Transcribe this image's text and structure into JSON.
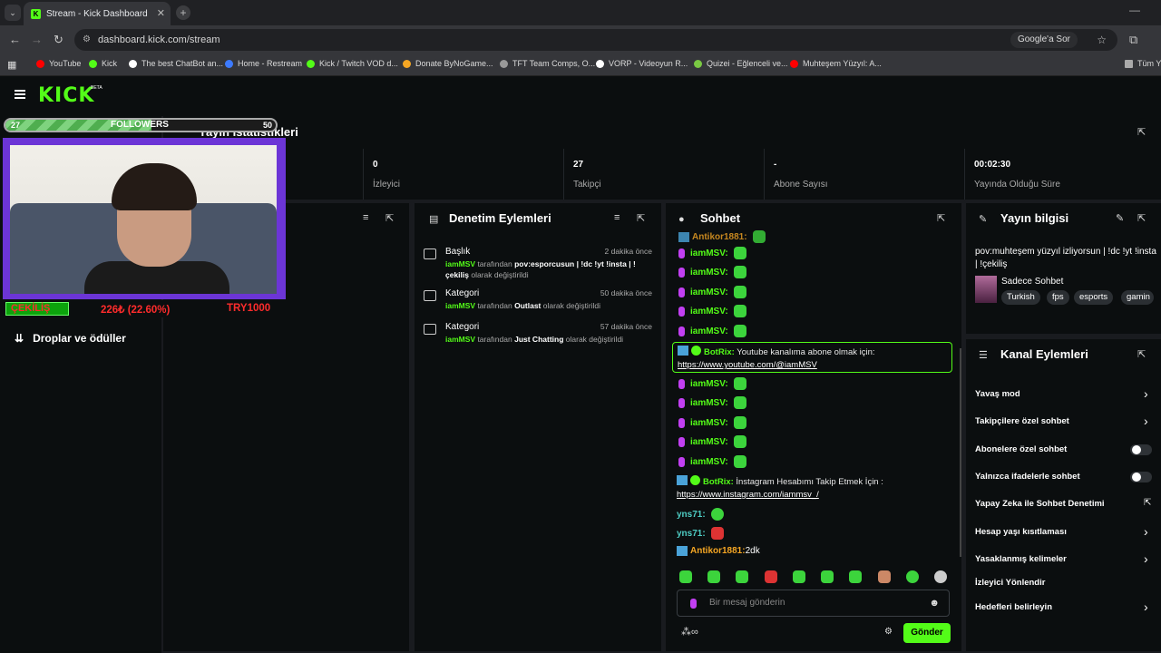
{
  "browser": {
    "tab_title": "Stream - Kick Dashboard",
    "url": "dashboard.kick.com/stream",
    "google_sor": "Google'a Sor",
    "bookmarks": [
      {
        "label": "YouTube",
        "color": "#ff0000"
      },
      {
        "label": "Kick",
        "color": "#53fc18"
      },
      {
        "label": "The best ChatBot an...",
        "color": "#ffffff"
      },
      {
        "label": "Home - Restream",
        "color": "#3d7bff"
      },
      {
        "label": "Kick / Twitch VOD d...",
        "color": "#53fc18"
      },
      {
        "label": "Donate ByNoGame...",
        "color": "#f5a623"
      },
      {
        "label": "TFT Team Comps, O...",
        "color": "#999999"
      },
      {
        "label": "VORP - Videoyun R...",
        "color": "#ffffff"
      },
      {
        "label": "Quizei - Eğlenceli ve...",
        "color": "#7ac943"
      },
      {
        "label": "Muhteşem Yüzyıl: A...",
        "color": "#ff0000"
      }
    ],
    "all_bookmarks": "Tüm Y"
  },
  "kick": {
    "logo": "KICK",
    "beta": "BETA"
  },
  "overlay": {
    "followers_current": "27",
    "followers_label": "FOLLOWERS",
    "followers_goal": "50",
    "followers_fraction": 0.54,
    "cekilis": "ÇEKİLİŞ",
    "amount": "226₺ (22.60%)",
    "target": "TRY1000"
  },
  "stats": {
    "title": "Yayın İstatistikleri",
    "items": [
      {
        "value": "0",
        "label": "İzleyici"
      },
      {
        "value": "27",
        "label": "Takipçi"
      },
      {
        "value": "-",
        "label": "Abone Sayısı"
      },
      {
        "value": "00:02:30",
        "label": "Yayında Olduğu Süre"
      }
    ]
  },
  "sidebar": {
    "drops": "Droplar ve ödüller"
  },
  "moderation": {
    "title": "Denetim Eylemleri",
    "items": [
      {
        "title": "Başlık",
        "time": "2 dakika önce",
        "user": "iamMSV",
        "by": " tarafından ",
        "value": "pov:esporcusun | !dc !yt !insta | !çekiliş",
        "suffix": " olarak değiştirildi"
      },
      {
        "title": "Kategori",
        "time": "50 dakika önce",
        "user": "iamMSV",
        "by": " tarafından ",
        "value": "Outlast",
        "suffix": " olarak değiştirildi"
      },
      {
        "title": "Kategori",
        "time": "57 dakika önce",
        "user": "iamMSV",
        "by": " tarafından ",
        "value": "Just Chatting",
        "suffix": " olarak değiştirildi"
      }
    ]
  },
  "chat": {
    "title": "Sohbet",
    "top_partial": "Antikor1881:",
    "msv_user": "iamMSV:",
    "bot1_user": "BotRix:",
    "bot1_text": " Youtube kanalıma abone olmak için:",
    "bot1_link": "https://www.youtube.com/@iamMSV",
    "bot2_user": "BotRix:",
    "bot2_text": " İnstagram Hesabımı Takip Etmek İçin :",
    "bot2_link": "https://www.instagram.com/iammsv_/",
    "yns1": "yns71:",
    "yns2": "yns71:",
    "antikor_user": "Antikor1881:",
    "antikor_text": " 2dk",
    "placeholder": "Bir mesaj gönderin",
    "send": "Gönder"
  },
  "info": {
    "title": "Yayın bilgisi",
    "stream_title": "pov:muhteşem yüzyıl izliyorsun | !dc !yt !insta | !çekiliş",
    "category": "Sadece Sohbet",
    "tags": [
      "Turkish",
      "fps",
      "esports",
      "gamin"
    ]
  },
  "channel": {
    "title": "Kanal Eylemleri",
    "actions": [
      {
        "label": "Yavaş mod",
        "control": "chevron"
      },
      {
        "label": "Takipçilere özel sohbet",
        "control": "chevron"
      },
      {
        "label": "Abonelere özel sohbet",
        "control": "toggle"
      },
      {
        "label": "Yalnızca ifadelerle sohbet",
        "control": "toggle"
      },
      {
        "label": "Yapay Zeka ile Sohbet Denetimi",
        "control": "external"
      },
      {
        "label": "Hesap yaşı kısıtlaması",
        "control": "chevron"
      },
      {
        "label": "Yasaklanmış kelimeler",
        "control": "chevron"
      },
      {
        "label": "İzleyici Yönlendir",
        "control": "none"
      },
      {
        "label": "Hedefleri belirleyin",
        "control": "chevron"
      }
    ]
  }
}
